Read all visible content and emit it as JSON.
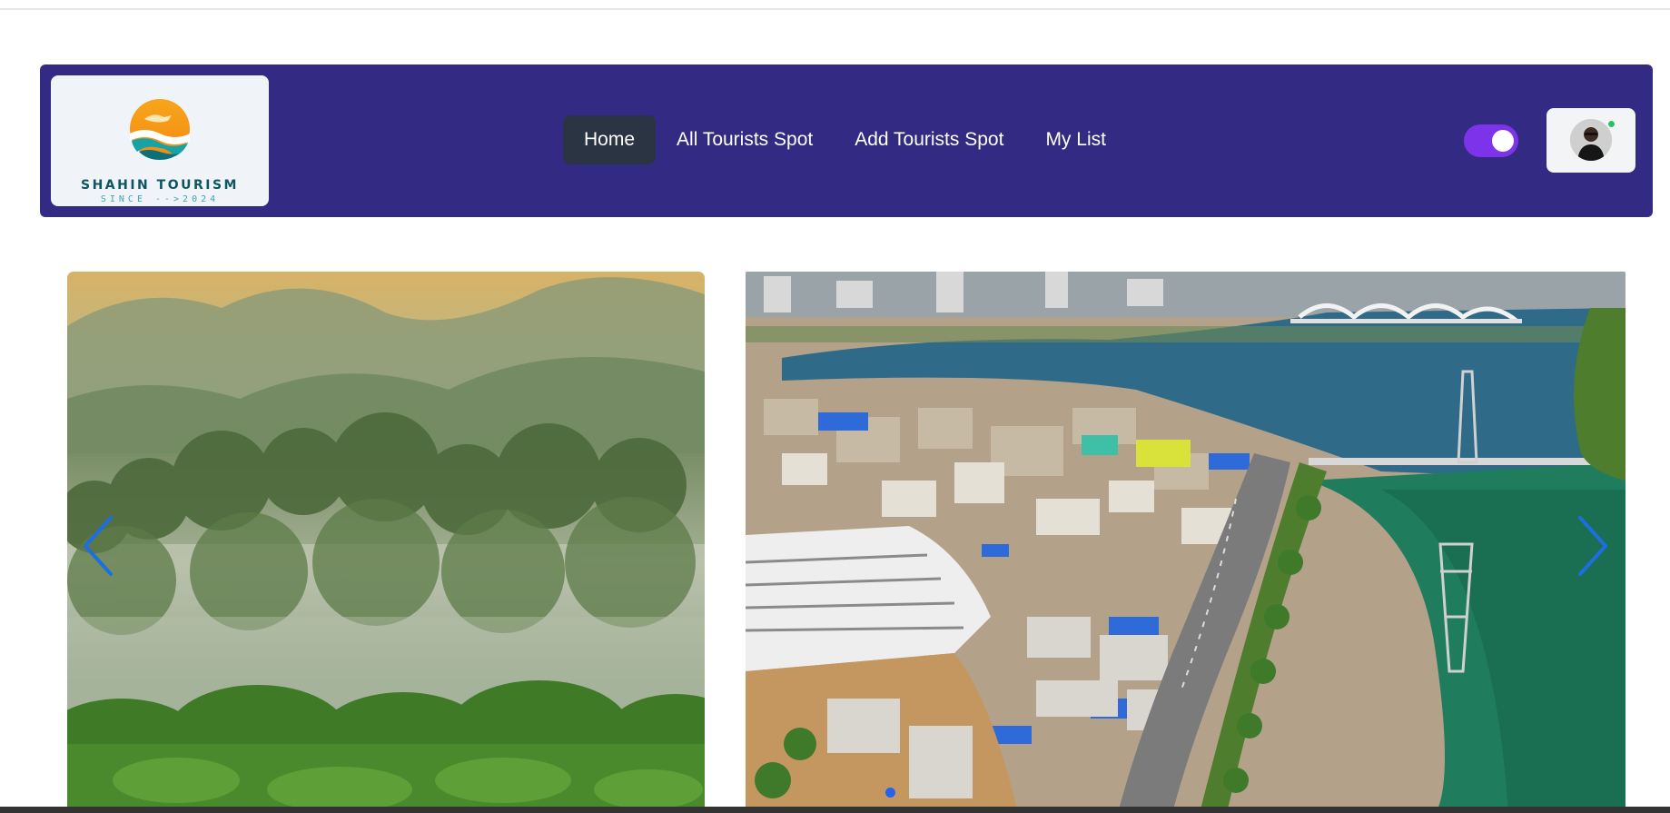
{
  "brand": {
    "name": "SHAHIN TOURISM",
    "since": "SINCE -->2024"
  },
  "nav": {
    "items": [
      {
        "label": "Home",
        "active": true
      },
      {
        "label": "All Tourists Spot",
        "active": false
      },
      {
        "label": "Add Tourists Spot",
        "active": false
      },
      {
        "label": "My List",
        "active": false
      }
    ]
  },
  "theme_toggle": {
    "on": true,
    "color": "#7d33e9"
  },
  "user": {
    "online": true
  },
  "slider": {
    "slides": [
      {
        "scene": "misty-forest-hills"
      },
      {
        "scene": "aerial-city-lake-bridge"
      }
    ]
  },
  "colors": {
    "navbar_bg": "#332a84",
    "active_item_bg": "#2b3442",
    "arrow": "#1d6fe0"
  }
}
